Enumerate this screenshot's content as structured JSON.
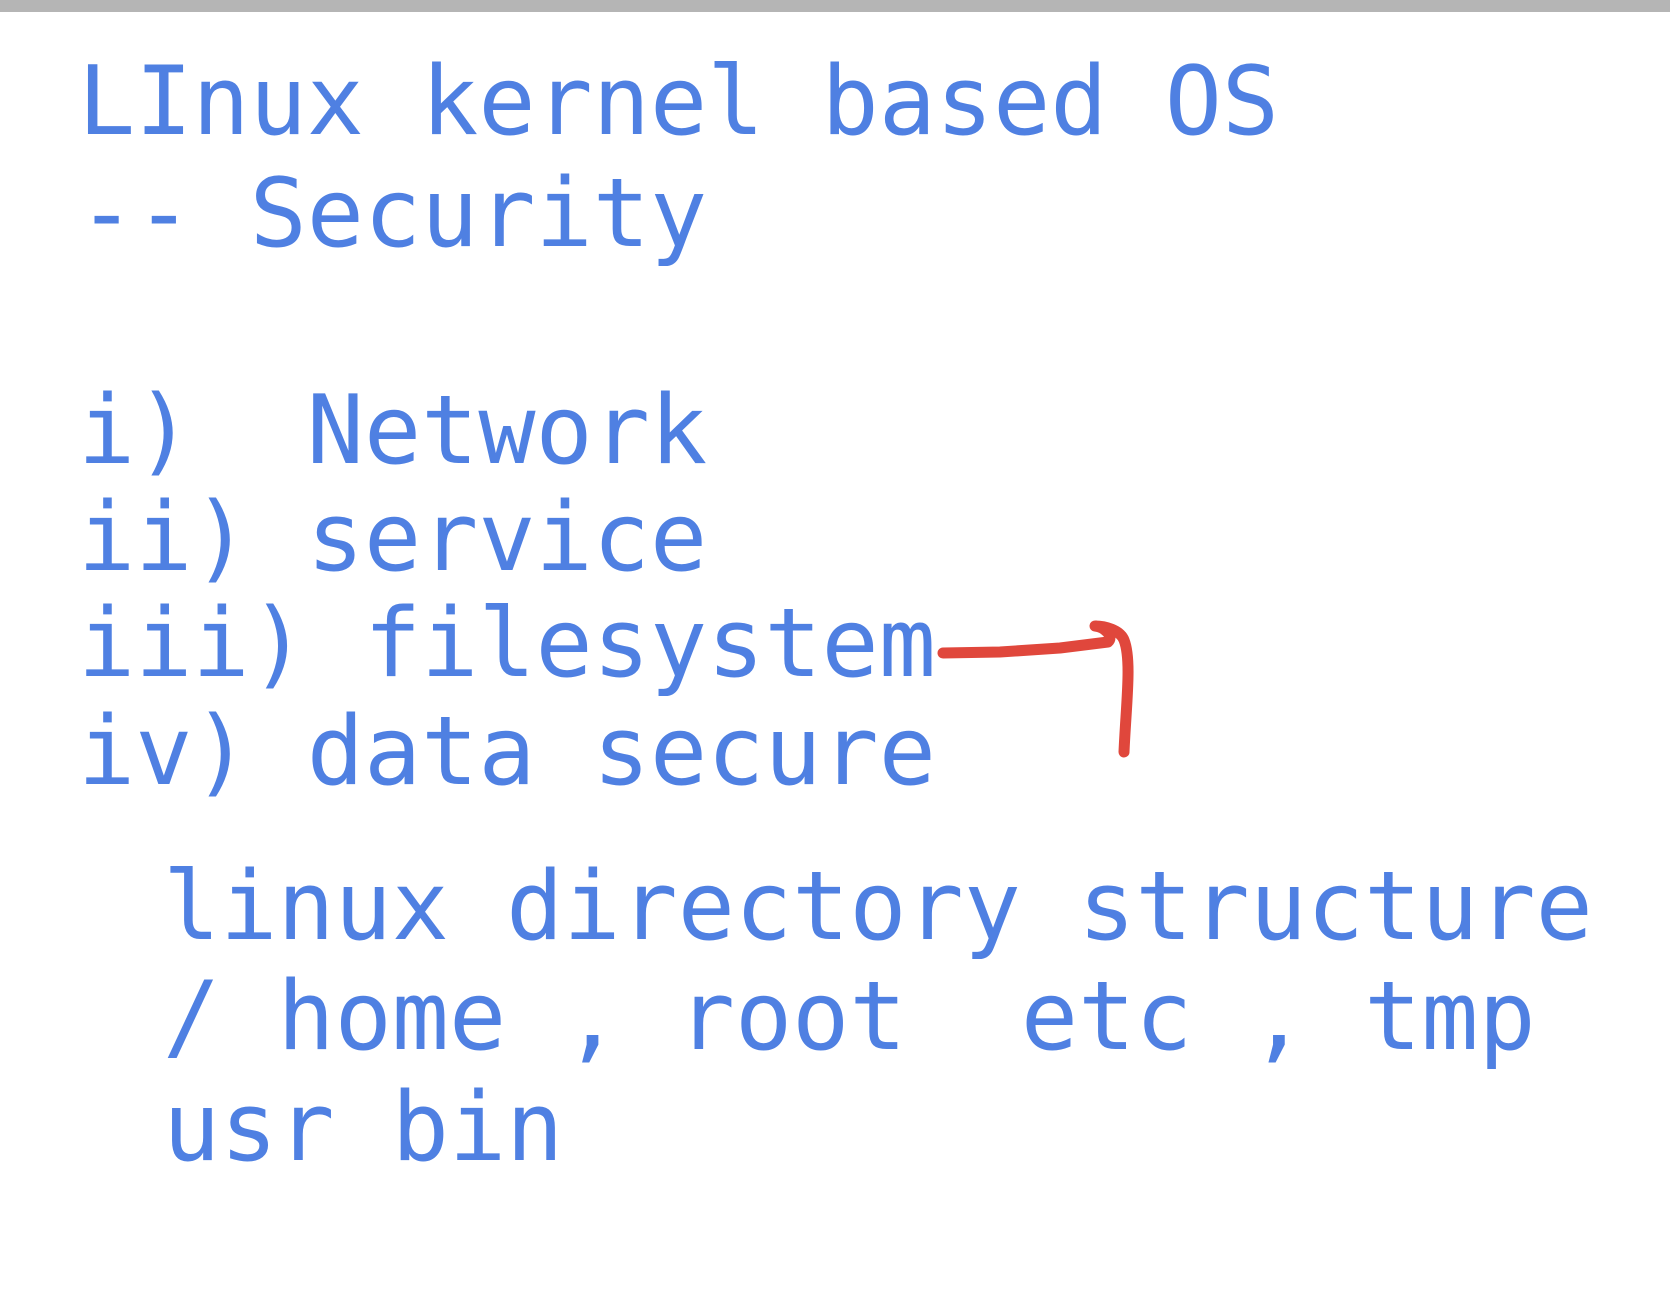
{
  "note": {
    "title_line_1": "LInux kernel based OS",
    "title_line_2": "-- Security",
    "items": [
      "i)  Network",
      "ii) service",
      "iii) filesystem",
      "iv) data secure"
    ],
    "sub_line_1": "linux directory structure",
    "sub_line_2": "/ home , root  etc , tmp",
    "sub_line_3": "usr bin"
  },
  "colors": {
    "text": "#4f80e2",
    "arrow": "#e0473c",
    "top_bar": "#b5b5b5"
  }
}
